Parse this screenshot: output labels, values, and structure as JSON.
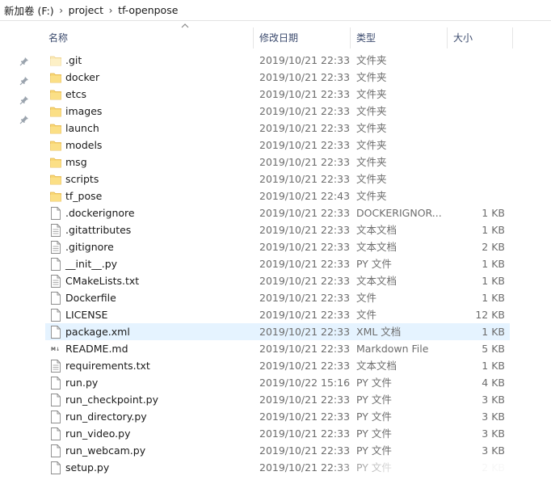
{
  "breadcrumb": [
    "新加卷 (F:)",
    "project",
    "tf-openpose"
  ],
  "columns": {
    "name": "名称",
    "date": "修改日期",
    "type": "类型",
    "size": "大小"
  },
  "selected_row": 16,
  "files": [
    {
      "name": ".git",
      "date": "2019/10/21 22:33",
      "type": "文件夹",
      "size": "",
      "icon": "folder-hidden-icon"
    },
    {
      "name": "docker",
      "date": "2019/10/21 22:33",
      "type": "文件夹",
      "size": "",
      "icon": "folder-icon"
    },
    {
      "name": "etcs",
      "date": "2019/10/21 22:33",
      "type": "文件夹",
      "size": "",
      "icon": "folder-icon"
    },
    {
      "name": "images",
      "date": "2019/10/21 22:33",
      "type": "文件夹",
      "size": "",
      "icon": "folder-icon"
    },
    {
      "name": "launch",
      "date": "2019/10/21 22:33",
      "type": "文件夹",
      "size": "",
      "icon": "folder-icon"
    },
    {
      "name": "models",
      "date": "2019/10/21 22:33",
      "type": "文件夹",
      "size": "",
      "icon": "folder-icon"
    },
    {
      "name": "msg",
      "date": "2019/10/21 22:33",
      "type": "文件夹",
      "size": "",
      "icon": "folder-icon"
    },
    {
      "name": "scripts",
      "date": "2019/10/21 22:33",
      "type": "文件夹",
      "size": "",
      "icon": "folder-icon"
    },
    {
      "name": "tf_pose",
      "date": "2019/10/21 22:43",
      "type": "文件夹",
      "size": "",
      "icon": "folder-icon"
    },
    {
      "name": ".dockerignore",
      "date": "2019/10/21 22:33",
      "type": "DOCKERIGNOR...",
      "size": "1 KB",
      "icon": "file-icon"
    },
    {
      "name": ".gitattributes",
      "date": "2019/10/21 22:33",
      "type": "文本文档",
      "size": "1 KB",
      "icon": "text-file-icon"
    },
    {
      "name": ".gitignore",
      "date": "2019/10/21 22:33",
      "type": "文本文档",
      "size": "2 KB",
      "icon": "text-file-icon"
    },
    {
      "name": "__init__.py",
      "date": "2019/10/21 22:33",
      "type": "PY 文件",
      "size": "1 KB",
      "icon": "file-icon"
    },
    {
      "name": "CMakeLists.txt",
      "date": "2019/10/21 22:33",
      "type": "文本文档",
      "size": "1 KB",
      "icon": "text-file-icon"
    },
    {
      "name": "Dockerfile",
      "date": "2019/10/21 22:33",
      "type": "文件",
      "size": "1 KB",
      "icon": "file-icon"
    },
    {
      "name": "LICENSE",
      "date": "2019/10/21 22:33",
      "type": "文件",
      "size": "12 KB",
      "icon": "file-icon"
    },
    {
      "name": "package.xml",
      "date": "2019/10/21 22:33",
      "type": "XML 文档",
      "size": "1 KB",
      "icon": "file-icon"
    },
    {
      "name": "README.md",
      "date": "2019/10/21 22:33",
      "type": "Markdown File",
      "size": "5 KB",
      "icon": "markdown-file-icon"
    },
    {
      "name": "requirements.txt",
      "date": "2019/10/21 22:33",
      "type": "文本文档",
      "size": "1 KB",
      "icon": "text-file-icon"
    },
    {
      "name": "run.py",
      "date": "2019/10/22 15:16",
      "type": "PY 文件",
      "size": "4 KB",
      "icon": "file-icon"
    },
    {
      "name": "run_checkpoint.py",
      "date": "2019/10/21 22:33",
      "type": "PY 文件",
      "size": "3 KB",
      "icon": "file-icon"
    },
    {
      "name": "run_directory.py",
      "date": "2019/10/21 22:33",
      "type": "PY 文件",
      "size": "3 KB",
      "icon": "file-icon"
    },
    {
      "name": "run_video.py",
      "date": "2019/10/21 22:33",
      "type": "PY 文件",
      "size": "3 KB",
      "icon": "file-icon"
    },
    {
      "name": "run_webcam.py",
      "date": "2019/10/21 22:33",
      "type": "PY 文件",
      "size": "3 KB",
      "icon": "file-icon"
    },
    {
      "name": "setup.py",
      "date": "2019/10/21 22:33",
      "type": "PY 文件",
      "size": "2 KB",
      "icon": "file-icon"
    }
  ]
}
